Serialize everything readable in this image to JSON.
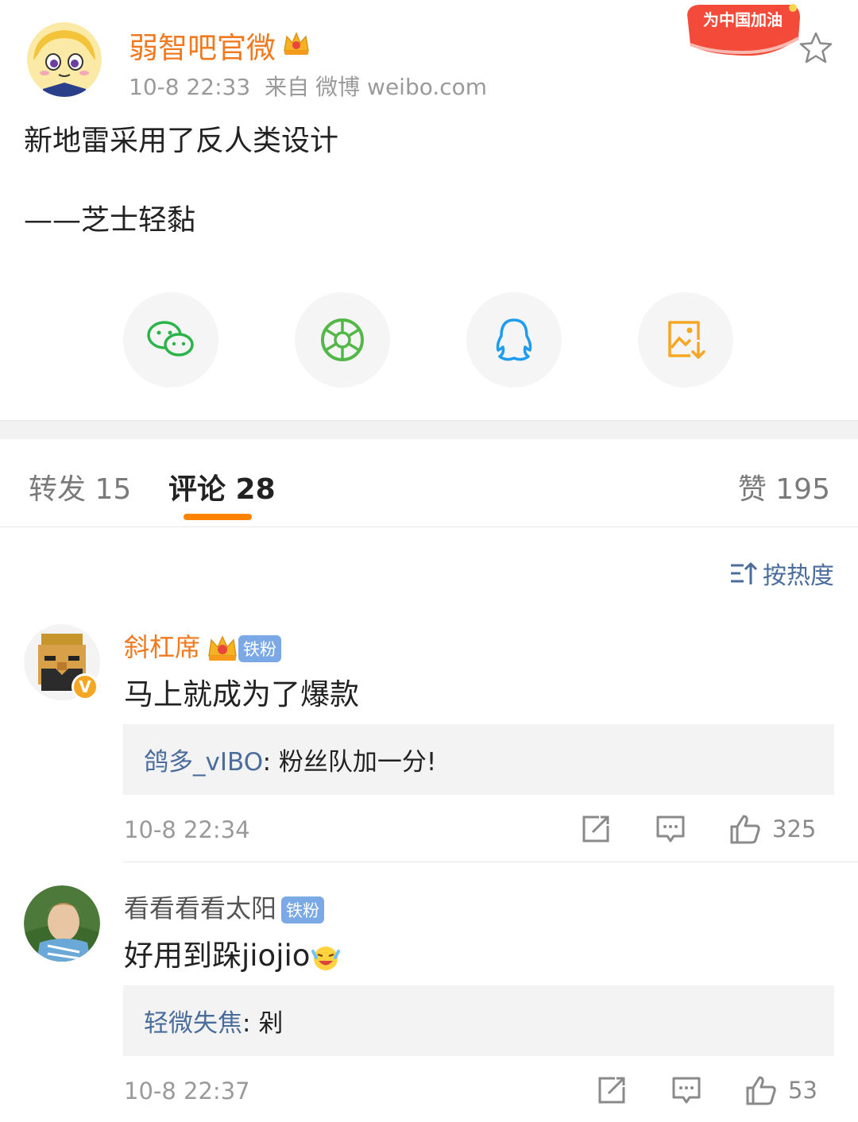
{
  "post": {
    "author": "弱智吧官微",
    "time": "10-8 22:33",
    "source_prefix": "来自",
    "source": "微博 weibo.com",
    "event_badge": "为中国加油",
    "lines": [
      "新地雷采用了反人类设计",
      "——芝士轻黏"
    ]
  },
  "share": [
    {
      "icon": "wechat-icon",
      "color": "#2bb44a"
    },
    {
      "icon": "moments-icon",
      "color": "#53b848"
    },
    {
      "icon": "qq-icon",
      "color": "#1f9bf0"
    },
    {
      "icon": "save-image-icon",
      "color": "#f5a623"
    }
  ],
  "tabs": {
    "repost": "转发 15",
    "comment": "评论 28",
    "like": "赞 195"
  },
  "sort_label": "按热度",
  "comments": [
    {
      "name": "斜杠席",
      "name_color": "#f17a20",
      "fan_badge": "铁粉",
      "text": "马上就成为了爆款",
      "reply_user": "鸽多_vIBO",
      "reply_text": ": 粉丝队加一分!",
      "time": "10-8 22:34",
      "likes": "325"
    },
    {
      "name": "看看看看太阳",
      "name_color": "#555555",
      "fan_badge": "铁粉",
      "text": "好用到跺jiojio",
      "reply_user": "轻微失焦",
      "reply_text": ": 剁",
      "time": "10-8 22:37",
      "likes": "53"
    }
  ],
  "colors": {
    "accent": "#ff8200",
    "link": "#4a6d9c"
  }
}
